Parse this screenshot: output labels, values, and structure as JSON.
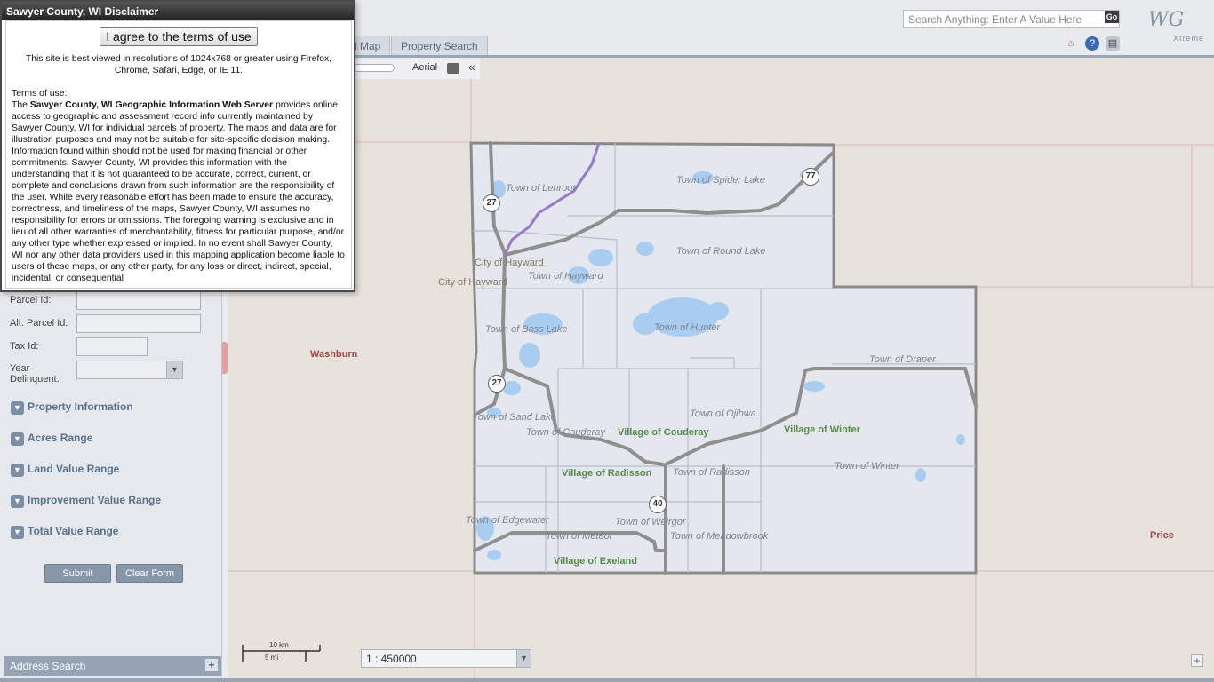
{
  "dialog": {
    "title": "Sawyer County, WI Disclaimer",
    "agree_button": "I agree to the terms of use",
    "best_viewed": "This site is best viewed in resolutions of 1024x768 or greater using Firefox, Chrome, Safari, Edge, or IE 11.",
    "terms_heading": "Terms of use:",
    "terms_prefix": "The",
    "terms_bold": "Sawyer County, WI Geographic Information Web Server",
    "terms_body": "provides online access to geographic and assessment record info currently maintained by Sawyer County, WI for individual parcels of property. The maps and data are for illustration purposes and may not be suitable for site-specific decision making. Information found within should not be used for making financial or other commitments. Sawyer County, WI provides this information with the understanding that it is not guaranteed to be accurate, correct, current, or complete and conclusions drawn from such information are the responsibility of the user. While every reasonable effort has been made to ensure the accuracy, correctness, and timeliness of the maps, Sawyer County, WI assumes no responsibility for errors or omissions. The foregoing warning is exclusive and in lieu of all other warranties of merchantability, fitness for particular purpose, and/or any other type whether expressed or implied. In no event shall Sawyer County, WI nor any other data providers used in this mapping application become liable to users of these maps, or any other party, for any loss or direct, indirect, special, incidental, or consequential"
  },
  "header": {
    "search_placeholder": "Search Anything: Enter A Value Here",
    "go_label": "Go",
    "logo_text": "WG",
    "logo_sub": "Xtreme",
    "tabs": [
      "d Map",
      "Property Search"
    ]
  },
  "toolbar": {
    "aerial_label": "Aerial",
    "collapse_glyph": "«"
  },
  "left_panel": {
    "fields": [
      {
        "label": "Parcel Id:"
      },
      {
        "label": "Alt. Parcel Id:"
      },
      {
        "label": "Tax Id:"
      },
      {
        "label": "Year Delinquent:"
      }
    ],
    "sections": [
      "Property Information",
      "Acres Range",
      "Land Value Range",
      "Improvement Value Range",
      "Total Value Range"
    ],
    "submit_label": "Submit",
    "clear_label": "Clear Form",
    "address_search": "Address Search",
    "address_plus": "+"
  },
  "map": {
    "counties": [
      "Washburn",
      "Price"
    ],
    "towns": [
      "Town of Lenroot",
      "Town of Spider Lake",
      "Town of Round Lake",
      "Town of Hayward",
      "Town of Bass Lake",
      "Town of Hunter",
      "Town of Draper",
      "Town of Ojibwa",
      "Town of Sand Lake",
      "Town of Couderay",
      "Town of Radisson",
      "Town of Winter",
      "Town of Edgewater",
      "Town of Weirgor",
      "Town of Meteor",
      "Town of Meadowbrook"
    ],
    "villages": [
      "Village of Couderay",
      "Village of Winter",
      "Village of Radisson",
      "Village of Exeland"
    ],
    "cities": [
      "City of Hayward",
      "City of Hayward"
    ],
    "shields": [
      "27",
      "77",
      "27",
      "40"
    ],
    "scalebar_km": "10 km",
    "scalebar_mi": "5 mi",
    "scale_value": "1 : 450000",
    "plus": "+"
  },
  "colors": {
    "county_fill": "#e4e8ee",
    "water": "#a9cdf0",
    "road": "#8f8f8f",
    "highway_purple": "#9a78c8",
    "background": "#e8e2dc"
  }
}
